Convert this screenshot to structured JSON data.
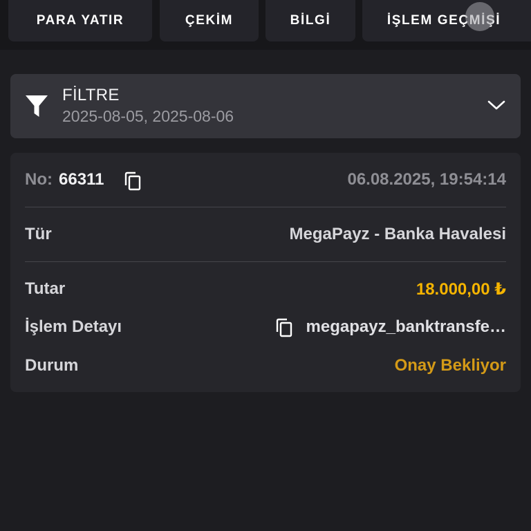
{
  "tabs": [
    {
      "label": "PARA YATIR"
    },
    {
      "label": "ÇEKİM"
    },
    {
      "label": "BİLGİ"
    },
    {
      "label": "İŞLEM GEÇMİŞİ"
    }
  ],
  "filter": {
    "title": "FİLTRE",
    "date_range": "2025-08-05, 2025-08-06",
    "icons": {
      "filter": "filter-funnel-icon",
      "toggle": "chevron-down-icon"
    }
  },
  "transaction": {
    "no_label": "No:",
    "no_value": "66311",
    "datetime": "06.08.2025, 19:54:14",
    "type_label": "Tür",
    "type_value": "MegaPayz - Banka Havalesi",
    "amount_label": "Tutar",
    "amount_value": "18.000,00 ₺",
    "detail_label": "İşlem Detayı",
    "detail_value": "megapayz_banktransfe…",
    "status_label": "Durum",
    "status_value": "Onay Bekliyor",
    "icons": {
      "copy": "copy-icon"
    }
  },
  "colors": {
    "background": "#1d1d21",
    "card": "#26262b",
    "filter_bar": "#34343a",
    "amount": "#f5b400",
    "status_pending": "#d49a17"
  }
}
